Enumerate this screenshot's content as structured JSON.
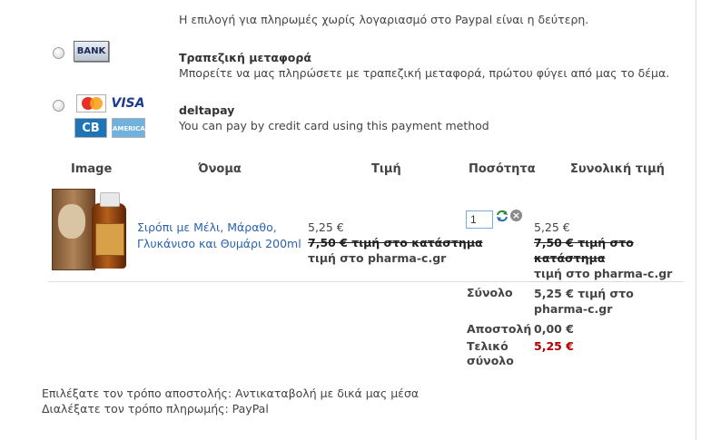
{
  "paypal": {
    "note": "Η επιλογή για πληρωμές χωρίς λογαριασμό στο Paypal είναι η δεύτερη."
  },
  "payment_methods": [
    {
      "icon": "bank-icon",
      "icon_text": "BANK",
      "title": "Τραπεζική μεταφορά",
      "description": "Μπορείτε να μας πληρώσετε με τραπεζική μεταφορά, πρώτου φύγει από μας το δέμα."
    },
    {
      "icon": "credit-cards-icon",
      "icon_text": [
        "VISA",
        "CB",
        "AMERICAN EXPRESS"
      ],
      "title": "deltapay",
      "description": "You can pay by credit card using this payment method"
    }
  ],
  "table": {
    "headers": [
      "Image",
      "Όνομα",
      "Τιμή",
      "Ποσότητα",
      "Συνολική τιμή"
    ],
    "rows": [
      {
        "name_line1": "Σιρόπι με Μέλι, Μάραθο,",
        "name_line2": "Γλυκάνισο και Θυμάρι 200ml",
        "price": "5,25 €",
        "old_price": "7,50 € τιμή στο κατάστημα",
        "price_note": "τιμή στο pharma-c.gr",
        "quantity": "1",
        "total_price": "5,25 €",
        "total_old_price": "7,50 € τιμή στο κατάστημα",
        "total_note": "τιμή στο pharma-c.gr"
      }
    ]
  },
  "summary": {
    "subtotal_label": "Σύνολο",
    "subtotal_value_line1": "5,25 € τιμή στο",
    "subtotal_value_line2": "pharma-c.gr",
    "shipping_label": "Αποστολή",
    "shipping_value": "0,00 €",
    "grand_total_label_line1": "Τελικό",
    "grand_total_label_line2": "σύνολο",
    "grand_total_value": "5,25 €"
  },
  "footer": {
    "shipping_choice": "Επιλέξατε τον τρόπο αποστολής: Αντικαταβολή με δικά μας μέσα",
    "payment_choice": "Διαλέξατε τον τρόπο πληρωμής: PayPal"
  },
  "colors": {
    "link": "#2a63b0",
    "total_red": "#b00000",
    "qty_border": "#7fa8d6"
  }
}
